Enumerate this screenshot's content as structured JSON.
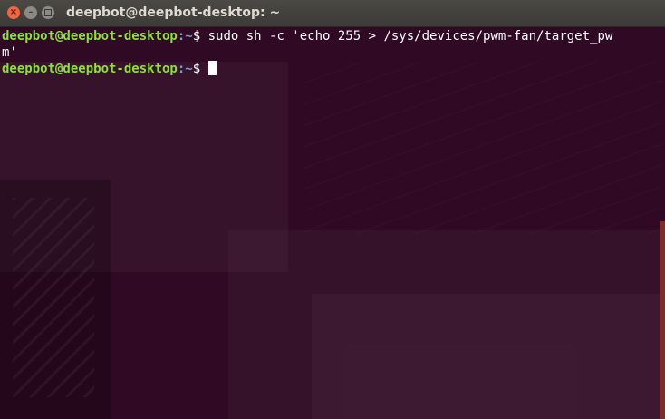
{
  "window": {
    "title": "deepbot@deepbot-desktop: ~",
    "close_glyph": "×",
    "minimize_glyph": "–"
  },
  "terminal": {
    "lines": [
      {
        "prompt": "deepbot@deepbot-desktop",
        "path": ":~",
        "symbol": "$ ",
        "command": "sudo sh -c 'echo 255 > /sys/devices/pwm-fan/target_pw"
      },
      {
        "continuation": "m'"
      },
      {
        "prompt": "deepbot@deepbot-desktop",
        "path": ":~",
        "symbol": "$ ",
        "command": ""
      }
    ]
  },
  "colors": {
    "background": "#300a24",
    "prompt": "#8ae234",
    "path": "#729fcf",
    "text": "#ffffff",
    "titlebar": "#3c3b37",
    "close_button": "#f1673b"
  }
}
